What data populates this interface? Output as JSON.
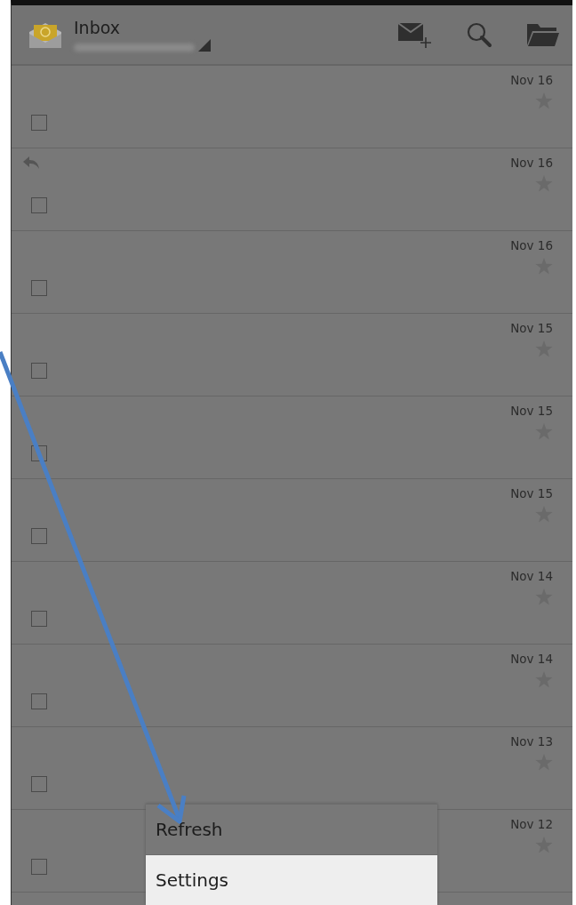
{
  "header": {
    "title": "Inbox"
  },
  "messages": [
    {
      "date": "Nov 16",
      "replied": false,
      "checked": false
    },
    {
      "date": "Nov 16",
      "replied": true,
      "checked": false
    },
    {
      "date": "Nov 16",
      "replied": false,
      "checked": false
    },
    {
      "date": "Nov 15",
      "replied": false,
      "checked": false
    },
    {
      "date": "Nov 15",
      "replied": false,
      "checked": false
    },
    {
      "date": "Nov 15",
      "replied": false,
      "checked": false
    },
    {
      "date": "Nov 14",
      "replied": false,
      "checked": false
    },
    {
      "date": "Nov 14",
      "replied": false,
      "checked": false
    },
    {
      "date": "Nov 13",
      "replied": false,
      "checked": false
    },
    {
      "date": "Nov 12",
      "replied": false,
      "checked": false
    }
  ],
  "menu": [
    {
      "label": "Refresh",
      "selected": false
    },
    {
      "label": "Settings",
      "selected": true
    }
  ]
}
